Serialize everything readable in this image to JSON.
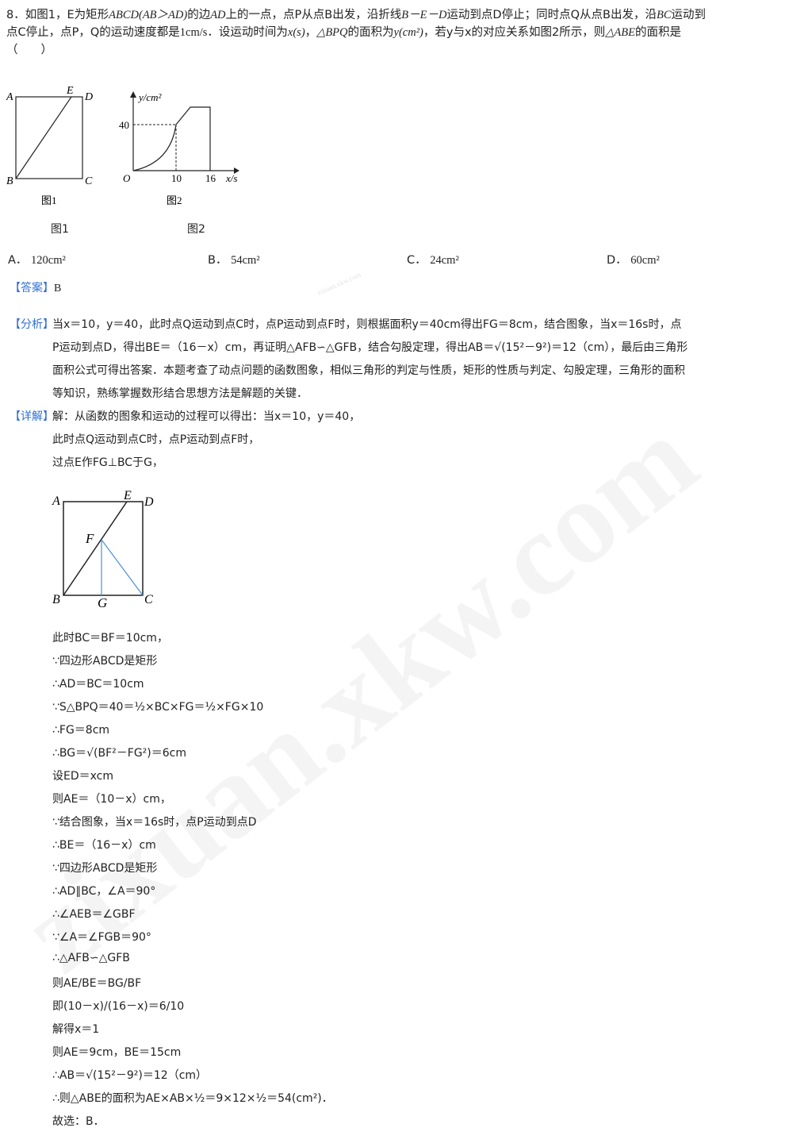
{
  "question": {
    "number": "8．",
    "l1a": "如图1，",
    "l1b": "E为矩形",
    "l1c": "ABCD(AB＞AD)",
    "l1d": "的边",
    "l1e": "AD",
    "l1f": "上的一点，点P从点B出发，沿折线",
    "l1g": "B－E－D",
    "l1h": "运动到点D停止；同时点Q从点B出发，沿",
    "l1i": "BC",
    "l1j": "运动到",
    "l2a": "点C停止，点P，Q的运动速度都是",
    "l2b": "1cm/s",
    "l2c": "．设运动时间为",
    "l2d": "x(s)",
    "l2e": "，",
    "l2f": "△BPQ",
    "l2g": "的面积为",
    "l2h": "y(cm²)",
    "l2i": "，若y与x的对应关系如图2所示，则",
    "l2j": "△ABE",
    "l2k": "的面积是",
    "l3": "（　　）"
  },
  "fig1": {
    "A": "A",
    "B": "B",
    "C": "C",
    "D": "D",
    "E": "E",
    "caption": "图1",
    "label": "图1"
  },
  "fig2": {
    "ylabel": "y/cm²",
    "xlabel": "x/s",
    "origin": "O",
    "y40": "40",
    "x10": "10",
    "x16": "16",
    "caption": "图2",
    "label": "图2"
  },
  "options": [
    {
      "key": "A．",
      "val": "120cm²"
    },
    {
      "key": "B．",
      "val": "54cm²"
    },
    {
      "key": "C．",
      "val": "24cm²"
    },
    {
      "key": "D．",
      "val": "60cm²"
    }
  ],
  "answer": {
    "tag": "【答案】",
    "val": "B"
  },
  "analysis": {
    "tag": "【分析】",
    "l1": "当x＝10，y＝40，此时点Q运动到点C时，点P运动到点F时，则根据面积y＝40cm得出FG＝8cm，结合图象，当x＝16s时，点",
    "l2": "P运动到点D，得出BE＝（16－x）cm，再证明△AFB∽△GFB，结合勾股定理，得出AB＝√(15²－9²)＝12（cm），最后由三角形",
    "l3": "面积公式可得出答案．本题考查了动点问题的函数图象，相似三角形的判定与性质，矩形的性质与判定、勾股定理，三角形的面积",
    "l4": "等知识，熟练掌握数形结合思想方法是解题的关键．"
  },
  "detail": {
    "tag": "【详解】",
    "l1": "解：从函数的图象和运动的过程可以得出：当x＝10，y＝40，",
    "l2": "此时点Q运动到点C时，点P运动到点F时，",
    "l3": "过点E作FG⊥BC于G，",
    "fig": {
      "A": "A",
      "B": "B",
      "C": "C",
      "D": "D",
      "E": "E",
      "F": "F",
      "G": "G"
    },
    "steps": [
      "此时BC＝BF＝10cm，",
      "∵四边形ABCD是矩形",
      "∴AD＝BC＝10cm",
      "∵S△BPQ＝40＝½×BC×FG＝½×FG×10",
      "∴FG＝8cm",
      "∴BG＝√(BF²－FG²)＝6cm",
      "设ED＝xcm",
      "则AE＝（10－x）cm，",
      "∵结合图象，当x＝16s时，点P运动到点D",
      "∴BE＝（16－x）cm",
      "∵四边形ABCD是矩形",
      "∴AD∥BC，∠A＝90°",
      "∴∠AEB＝∠GBF",
      "∵∠A＝∠FGB＝90°",
      "∴△AFB∽△GFB",
      "则AE/BE＝BG/BF",
      "即(10－x)/(16－x)＝6/10",
      "解得x＝1",
      "则AE＝9cm，BE＝15cm",
      "∴AB＝√(15²－9²)＝12（cm）",
      "∴则△ABE的面积为AE×AB×½＝9×12×½＝54(cm²)．",
      "故选：B．"
    ]
  },
  "watermark": {
    "big": "zixuan.xkw.com",
    "small": "zixuan.xkw.com"
  }
}
